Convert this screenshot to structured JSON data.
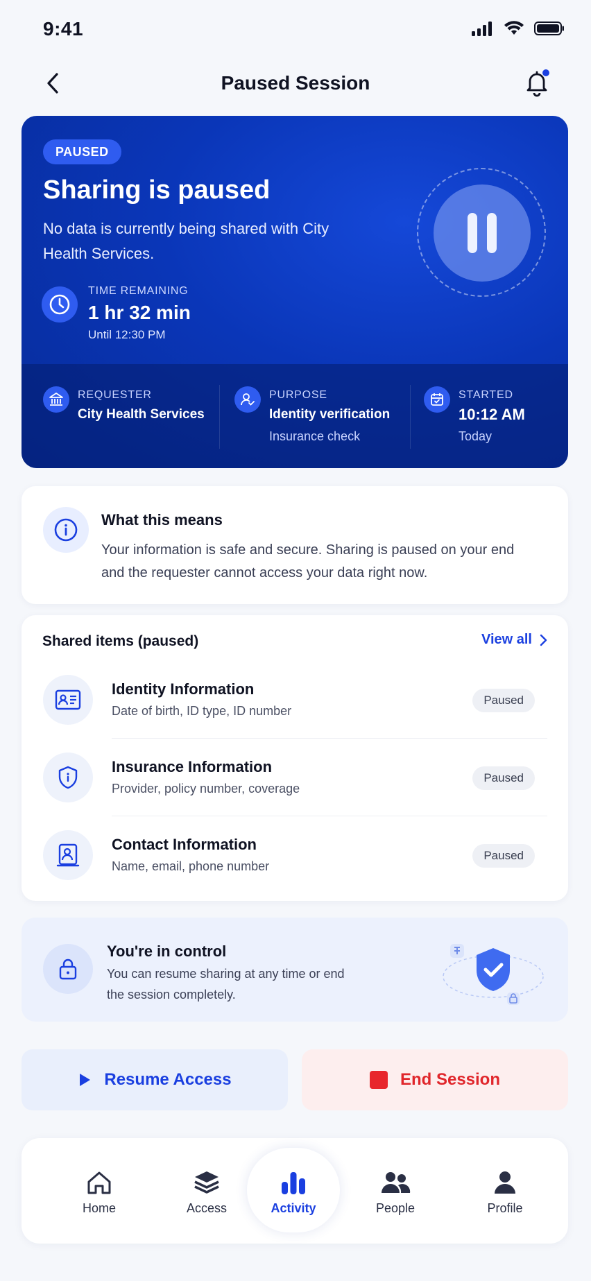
{
  "status_bar": {
    "time": "9:41"
  },
  "header": {
    "title": "Paused Session"
  },
  "hero": {
    "badge": "PAUSED",
    "title": "Sharing is paused",
    "description": "No data is currently being shared with City Health Services.",
    "time_remaining_label": "TIME REMAINING",
    "time_remaining_value": "1 hr 32 min",
    "until": "Until 12:30 PM",
    "requester_label": "REQUESTER",
    "requester_value": "City Health Services",
    "purpose_label": "PURPOSE",
    "purpose_value": "Identity verification",
    "purpose_sub": "Insurance check",
    "started_label": "STARTED",
    "started_value": "10:12 AM",
    "started_sub": "Today"
  },
  "info": {
    "title": "What this means",
    "body": "Your information is safe and secure. Sharing is paused on your end and the requester cannot access your data right now."
  },
  "shared": {
    "title": "Shared items (paused)",
    "view_all": "View all",
    "items": [
      {
        "title": "Identity Information",
        "sub": "Date of birth, ID type, ID number",
        "status": "Paused",
        "icon": "id-card-icon"
      },
      {
        "title": "Insurance Information",
        "sub": "Provider, policy number, coverage",
        "status": "Paused",
        "icon": "shield-icon"
      },
      {
        "title": "Contact Information",
        "sub": "Name, email, phone number",
        "status": "Paused",
        "icon": "contact-icon"
      }
    ]
  },
  "control": {
    "title": "You're in control",
    "body": "You can resume sharing at any time or end the session completely."
  },
  "actions": {
    "resume": "Resume Access",
    "end": "End Session"
  },
  "tabs": [
    {
      "label": "Home",
      "icon": "home-icon"
    },
    {
      "label": "Access",
      "icon": "layers-icon"
    },
    {
      "label": "Activity",
      "icon": "bar-chart-icon",
      "active": true
    },
    {
      "label": "People",
      "icon": "people-icon"
    },
    {
      "label": "Profile",
      "icon": "person-icon"
    }
  ],
  "colors": {
    "accent": "#1a3fe0",
    "hero": "#0a36b8",
    "danger": "#e0262b"
  }
}
